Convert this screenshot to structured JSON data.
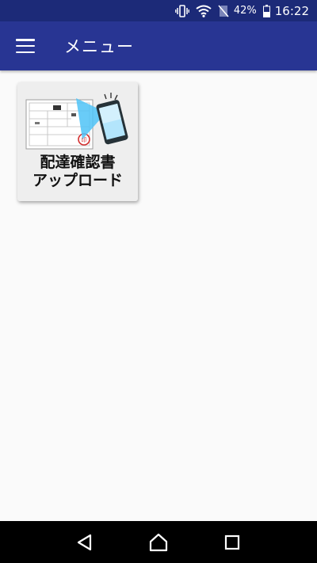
{
  "status_bar": {
    "battery_percent": "42%",
    "time": "16:22",
    "icons": [
      "vibrate-icon",
      "wifi-icon",
      "no-sim-icon",
      "battery-icon"
    ]
  },
  "app_bar": {
    "title": "メニュー",
    "menu_icon": "hamburger-menu-icon"
  },
  "menu": {
    "tiles": [
      {
        "label_line1": "配達確認書",
        "label_line2": "アップロード",
        "icon": "document-scan-phone-icon"
      }
    ]
  },
  "nav_bar": {
    "buttons": [
      "back-icon",
      "home-icon",
      "recents-icon"
    ]
  },
  "colors": {
    "status_bar": "#1c2a78",
    "app_bar": "#283593",
    "background": "#fafafa",
    "tile": "#eeeeee",
    "stamp_red": "#d32f2f",
    "scan_beam": "#4fc3f7"
  }
}
